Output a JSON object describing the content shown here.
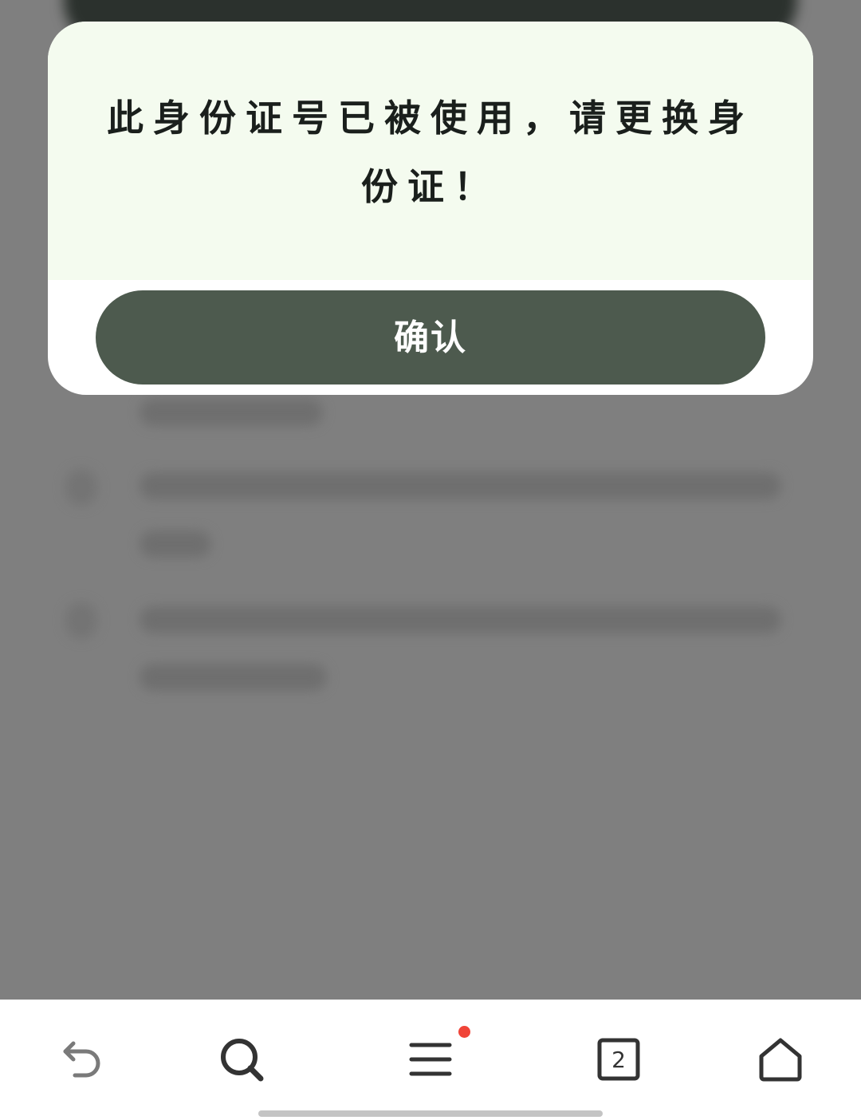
{
  "dialog": {
    "message": "此身份证号已被使用，请更换身份证！",
    "confirm_label": "确认"
  },
  "bottom_nav": {
    "items": [
      {
        "name": "back",
        "icon": "back-arrow-icon"
      },
      {
        "name": "search",
        "icon": "search-icon"
      },
      {
        "name": "menu",
        "icon": "menu-icon",
        "has_badge": true
      },
      {
        "name": "tabs",
        "icon": "tabs-icon",
        "count": "2"
      },
      {
        "name": "home",
        "icon": "home-icon"
      }
    ]
  },
  "colors": {
    "overlay": "#7f7f7f",
    "dialog_body": "#f4fbef",
    "confirm_button": "#4d5a4e",
    "badge": "#f04438"
  }
}
